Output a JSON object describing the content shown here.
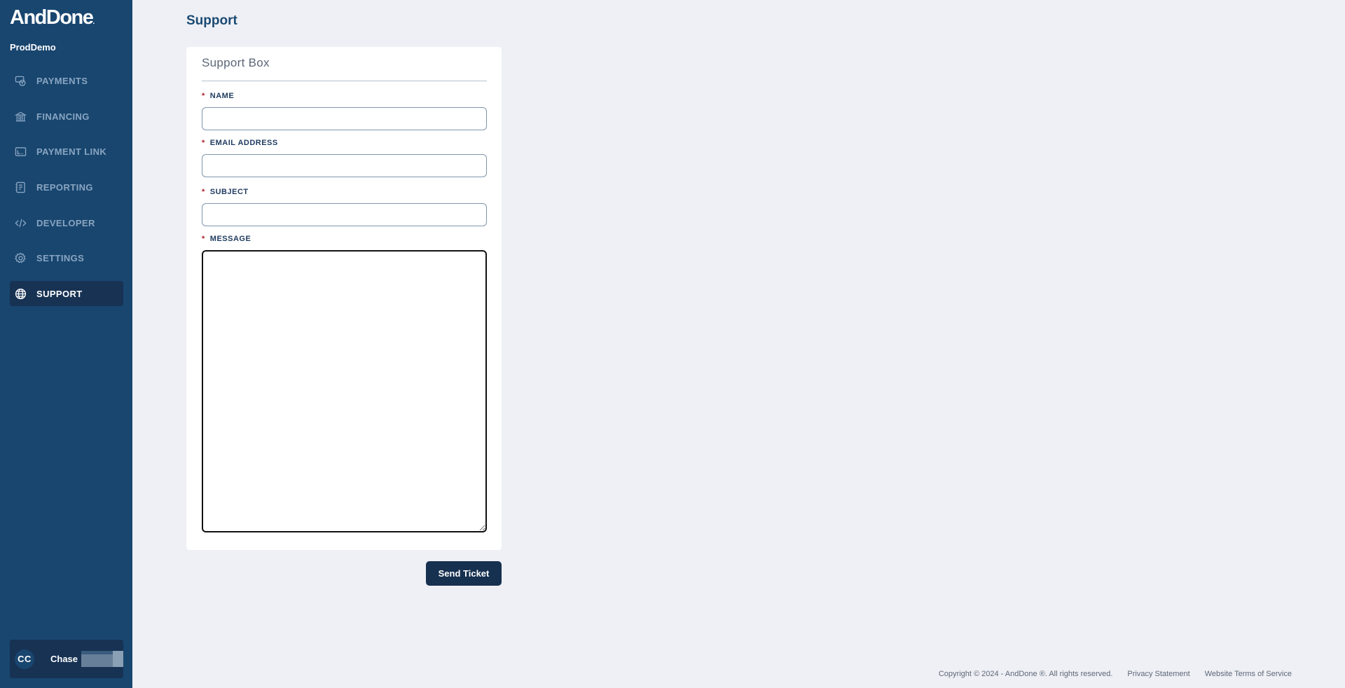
{
  "sidebar": {
    "logo": "AndDone",
    "logo_mark": ".",
    "org_name": "ProdDemo",
    "items": [
      {
        "label": "PAYMENTS",
        "icon": "payments-icon",
        "active": false
      },
      {
        "label": "FINANCING",
        "icon": "bank-icon",
        "active": false
      },
      {
        "label": "PAYMENT LINK",
        "icon": "payment-link-icon",
        "active": false
      },
      {
        "label": "REPORTING",
        "icon": "report-icon",
        "active": false
      },
      {
        "label": "DEVELOPER",
        "icon": "code-icon",
        "active": false
      },
      {
        "label": "SETTINGS",
        "icon": "gear-icon",
        "active": false
      },
      {
        "label": "SUPPORT",
        "icon": "globe-icon",
        "active": true
      }
    ],
    "user": {
      "initials": "CC",
      "first_name": "Chase"
    }
  },
  "main": {
    "page_title": "Support",
    "card": {
      "title": "Support Box",
      "fields": [
        {
          "label": "NAME",
          "required_mark": "*",
          "value": "",
          "placeholder": ""
        },
        {
          "label": "EMAIL ADDRESS",
          "required_mark": "*",
          "value": "",
          "placeholder": ""
        },
        {
          "label": "SUBJECT",
          "required_mark": "*",
          "value": "",
          "placeholder": ""
        },
        {
          "label": "MESSAGE",
          "required_mark": "*",
          "value": "",
          "placeholder": ""
        }
      ]
    },
    "send_button_label": "Send Ticket"
  },
  "footer": {
    "copyright": "Copyright © 2024 - AndDone ®. All rights reserved.",
    "privacy_link": "Privacy Statement",
    "terms_link": "Website Terms of Service"
  },
  "colors": {
    "sidebar_bg": "#18466f",
    "active_item_bg": "#173253",
    "primary_button": "#16304f",
    "page_bg": "#eff0f5",
    "required_mark": "#b01d2d"
  }
}
